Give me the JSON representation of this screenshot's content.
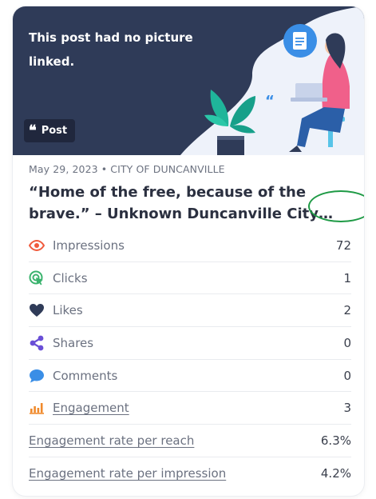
{
  "hero": {
    "no_picture_text": "This post had no picture linked.",
    "badge_label": "Post",
    "colors": {
      "navy": "#2f3b58",
      "light": "#eef2fa"
    }
  },
  "post": {
    "meta": "May 29, 2023 • CITY OF DUNCANVILLE",
    "title": "“Home of the free, because of the brave.” – Unknown Duncanville City Council"
  },
  "stats": [
    {
      "name": "impressions",
      "label": "Impressions",
      "value": "72",
      "icon": "eye-icon",
      "color": "#f05a3c"
    },
    {
      "name": "clicks",
      "label": "Clicks",
      "value": "1",
      "icon": "cursor-click-icon",
      "color": "#3bb36e"
    },
    {
      "name": "likes",
      "label": "Likes",
      "value": "2",
      "icon": "heart-icon",
      "color": "#2f3b58"
    },
    {
      "name": "shares",
      "label": "Shares",
      "value": "0",
      "icon": "share-icon",
      "color": "#6a4fd6"
    },
    {
      "name": "comments",
      "label": "Comments",
      "value": "0",
      "icon": "comment-icon",
      "color": "#3a8ee6"
    },
    {
      "name": "engagement",
      "label": "Engagement",
      "value": "3",
      "icon": "bar-chart-icon",
      "color": "#f08a2c"
    },
    {
      "name": "engagement-rate-reach",
      "label": "Engagement rate per reach",
      "value": "6.3%"
    },
    {
      "name": "engagement-rate-impression",
      "label": "Engagement rate per impression",
      "value": "4.2%"
    }
  ]
}
